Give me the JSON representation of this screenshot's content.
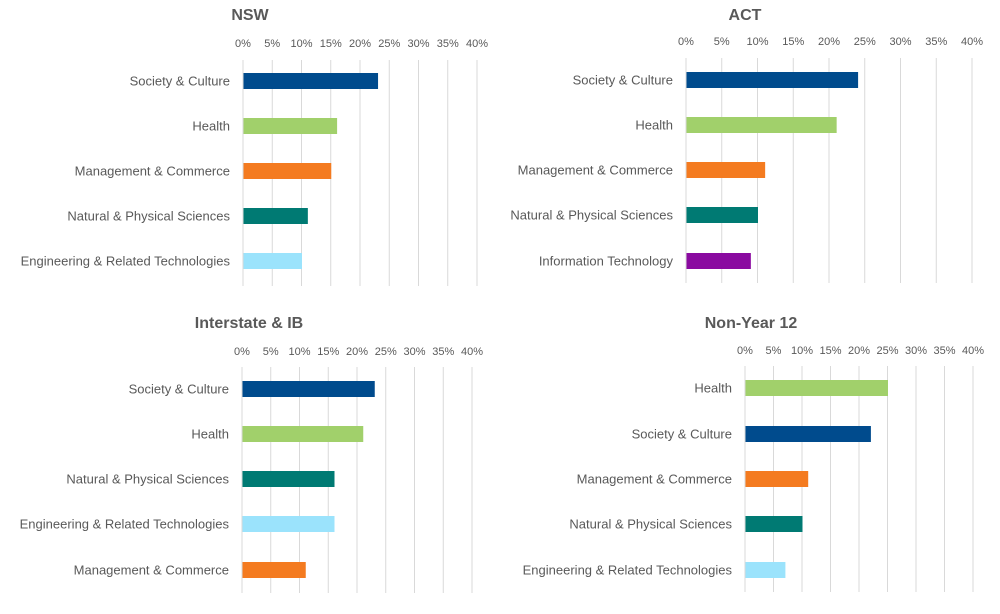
{
  "colors": {
    "Society & Culture": "#004b8d",
    "Health": "#a1d06b",
    "Management & Commerce": "#f47b20",
    "Natural & Physical Sciences": "#007a73",
    "Engineering & Related Technologies": "#9be3fc",
    "Information Technology": "#8a0aa0"
  },
  "chart_data": [
    {
      "type": "bar",
      "orientation": "horizontal",
      "title": "NSW",
      "categories": [
        "Society & Culture",
        "Health",
        "Management & Commerce",
        "Natural & Physical Sciences",
        "Engineering & Related Technologies"
      ],
      "values": [
        23,
        16,
        15,
        11,
        10
      ],
      "unit": "%",
      "xlim": [
        0,
        40
      ],
      "xticks": [
        "0%",
        "5%",
        "10%",
        "15%",
        "20%",
        "25%",
        "30%",
        "35%",
        "40%"
      ],
      "xaxis_position": "top",
      "grid": true,
      "legend": "none"
    },
    {
      "type": "bar",
      "orientation": "horizontal",
      "title": "ACT",
      "categories": [
        "Society & Culture",
        "Health",
        "Management & Commerce",
        "Natural & Physical Sciences",
        "Information Technology"
      ],
      "values": [
        24,
        21,
        11,
        10,
        9
      ],
      "unit": "%",
      "xlim": [
        0,
        40
      ],
      "xticks": [
        "0%",
        "5%",
        "10%",
        "15%",
        "20%",
        "25%",
        "30%",
        "35%",
        "40%"
      ],
      "xaxis_position": "top",
      "grid": true,
      "legend": "none"
    },
    {
      "type": "bar",
      "orientation": "horizontal",
      "title": "Interstate & IB",
      "categories": [
        "Society & Culture",
        "Health",
        "Natural & Physical Sciences",
        "Engineering & Related Technologies",
        "Management & Commerce"
      ],
      "values": [
        23,
        21,
        16,
        16,
        11
      ],
      "unit": "%",
      "xlim": [
        0,
        40
      ],
      "xticks": [
        "0%",
        "5%",
        "10%",
        "15%",
        "20%",
        "25%",
        "30%",
        "35%",
        "40%"
      ],
      "xaxis_position": "top",
      "grid": true,
      "legend": "none"
    },
    {
      "type": "bar",
      "orientation": "horizontal",
      "title": "Non-Year 12",
      "categories": [
        "Health",
        "Society & Culture",
        "Management & Commerce",
        "Natural & Physical Sciences",
        "Engineering & Related Technologies"
      ],
      "values": [
        25,
        22,
        11,
        10,
        7
      ],
      "unit": "%",
      "xlim": [
        0,
        40
      ],
      "xticks": [
        "0%",
        "5%",
        "10%",
        "15%",
        "20%",
        "25%",
        "30%",
        "35%",
        "40%"
      ],
      "xaxis_position": "top",
      "grid": true,
      "legend": "none"
    }
  ]
}
